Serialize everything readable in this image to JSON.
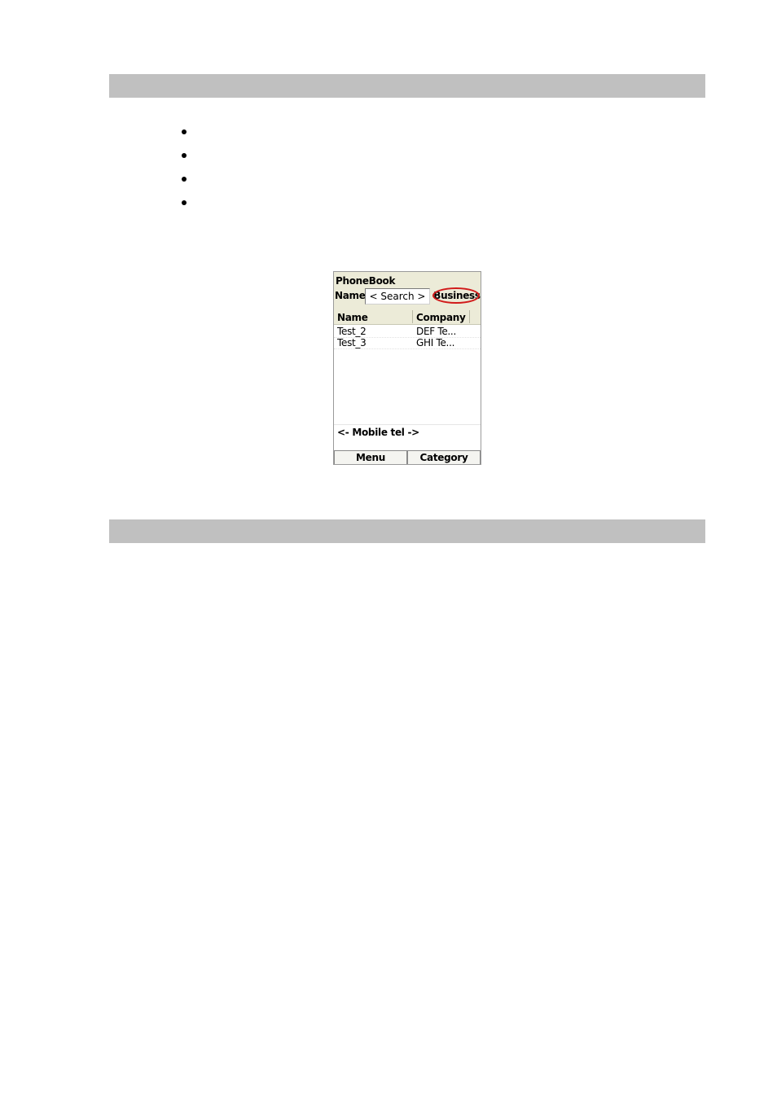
{
  "bullets": [
    "",
    "",
    "",
    ""
  ],
  "phonebook": {
    "title": "PhoneBook",
    "filter_label": "Name",
    "search_text": "< Search >",
    "category_current": "Business",
    "columns": {
      "name": "Name",
      "company": "Company"
    },
    "rows": [
      {
        "name": "Test_2",
        "company": "DEF Te..."
      },
      {
        "name": "Test_3",
        "company": "GHI Te..."
      }
    ],
    "detail_field": "<- Mobile tel ->",
    "softkeys": {
      "left": "Menu",
      "right": "Category"
    },
    "highlight_color": "#d11a1a"
  }
}
